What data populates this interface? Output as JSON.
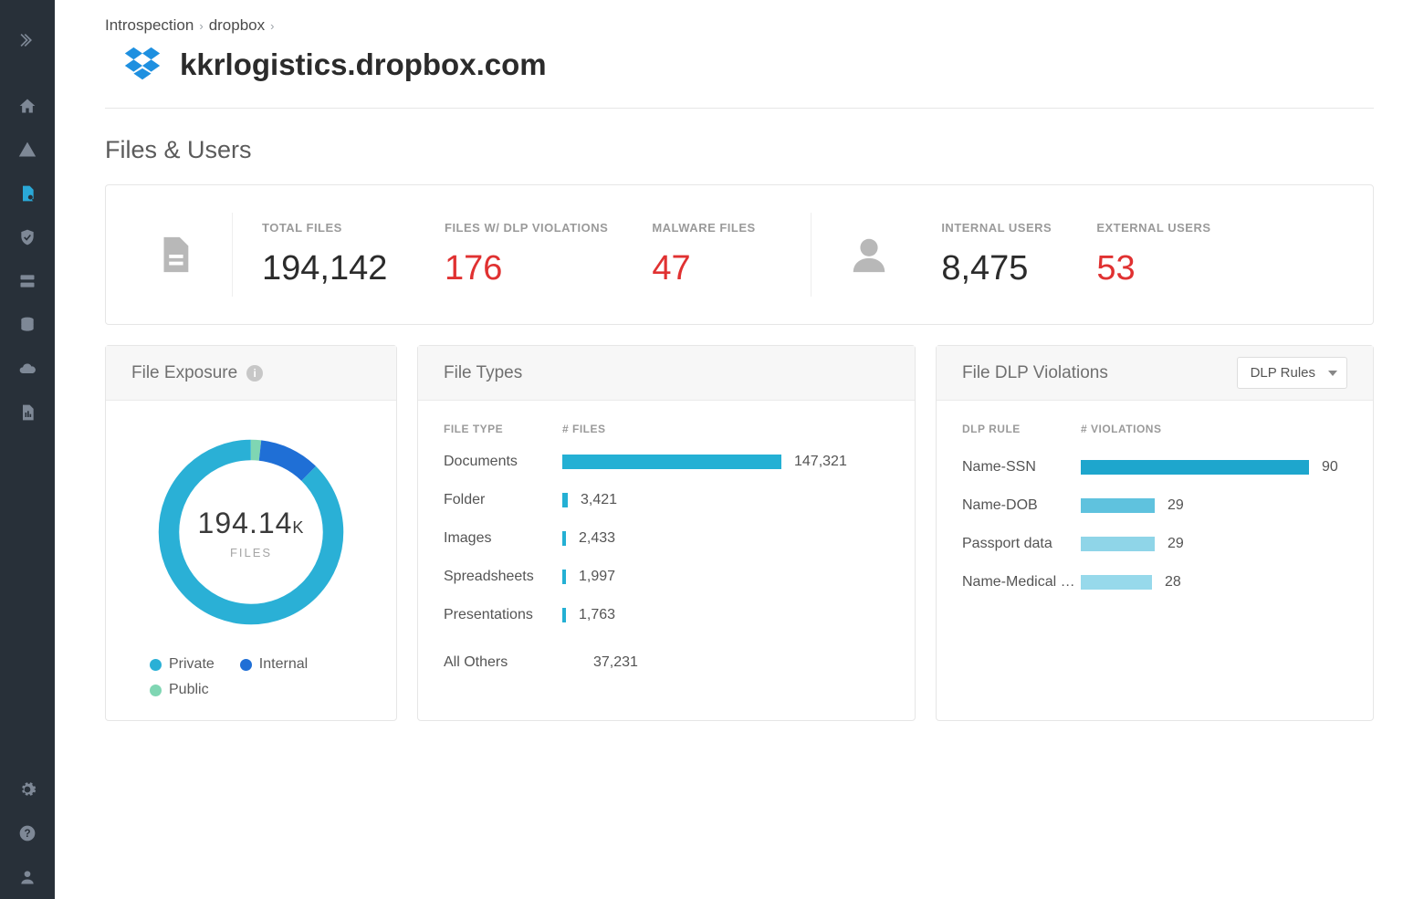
{
  "breadcrumb": {
    "item1": "Introspection",
    "item2": "dropbox"
  },
  "page_title": "kkrlogistics.dropbox.com",
  "section_title": "Files & Users",
  "stats": {
    "total_files": {
      "label": "TOTAL FILES",
      "value": "194,142"
    },
    "dlp_violations": {
      "label": "FILES W/ DLP VIOLATIONS",
      "value": "176"
    },
    "malware": {
      "label": "MALWARE FILES",
      "value": "47"
    },
    "internal_users": {
      "label": "INTERNAL USERS",
      "value": "8,475"
    },
    "external_users": {
      "label": "EXTERNAL USERS",
      "value": "53"
    }
  },
  "exposure": {
    "title": "File Exposure",
    "center_value": "194.14",
    "center_suffix": "K",
    "center_label": "FILES",
    "legend": [
      {
        "label": "Private",
        "color": "#2ab0d6"
      },
      {
        "label": "Internal",
        "color": "#1f6fd6"
      },
      {
        "label": "Public",
        "color": "#7fd6b3"
      }
    ]
  },
  "file_types": {
    "title": "File Types",
    "col1": "FILE TYPE",
    "col2": "# FILES",
    "max": 147321,
    "rows": [
      {
        "name": "Documents",
        "value_text": "147,321",
        "value": 147321
      },
      {
        "name": "Folder",
        "value_text": "3,421",
        "value": 3421
      },
      {
        "name": "Images",
        "value_text": "2,433",
        "value": 2433
      },
      {
        "name": "Spreadsheets",
        "value_text": "1,997",
        "value": 1997
      },
      {
        "name": "Presentations",
        "value_text": "1,763",
        "value": 1763
      }
    ],
    "all_others": {
      "name": "All Others",
      "value_text": "37,231"
    }
  },
  "dlp": {
    "title": "File DLP Violations",
    "dropdown": "DLP Rules",
    "col1": "DLP RULE",
    "col2": "# VIOLATIONS",
    "max": 90,
    "rows": [
      {
        "name": "Name-SSN",
        "value_text": "90",
        "value": 90,
        "color": "#1ea6cd"
      },
      {
        "name": "Name-DOB",
        "value_text": "29",
        "value": 29,
        "color": "#5fc2de"
      },
      {
        "name": "Passport data",
        "value_text": "29",
        "value": 29,
        "color": "#8fd5e8"
      },
      {
        "name": "Name-Medical C…",
        "value_text": "28",
        "value": 28,
        "color": "#97d9eb"
      }
    ]
  },
  "chart_data": [
    {
      "type": "pie",
      "title": "File Exposure",
      "total_label": "194.14K FILES",
      "series": [
        {
          "name": "Private",
          "color": "#2ab0d6",
          "fraction_estimate": 0.87
        },
        {
          "name": "Internal",
          "color": "#1f6fd6",
          "fraction_estimate": 0.11
        },
        {
          "name": "Public",
          "color": "#7fd6b3",
          "fraction_estimate": 0.02
        }
      ]
    },
    {
      "type": "bar",
      "title": "File Types",
      "xlabel": "# FILES",
      "categories": [
        "Documents",
        "Folder",
        "Images",
        "Spreadsheets",
        "Presentations",
        "All Others"
      ],
      "values": [
        147321,
        3421,
        2433,
        1997,
        1763,
        37231
      ]
    },
    {
      "type": "bar",
      "title": "File DLP Violations",
      "xlabel": "# VIOLATIONS",
      "categories": [
        "Name-SSN",
        "Name-DOB",
        "Passport data",
        "Name-Medical C…"
      ],
      "values": [
        90,
        29,
        29,
        28
      ]
    }
  ]
}
